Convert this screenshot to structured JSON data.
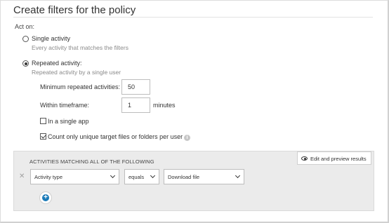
{
  "header": {
    "title": "Create filters for the policy"
  },
  "act_on": {
    "label": "Act on:",
    "single": {
      "label": "Single activity",
      "description": "Every activity that matches the filters",
      "selected": false
    },
    "repeated": {
      "label": "Repeated activity:",
      "description": "Repeated activity by a single user",
      "selected": true
    }
  },
  "repeated_settings": {
    "min_label": "Minimum repeated activities:",
    "min_value": "50",
    "timeframe_label": "Within timeframe:",
    "timeframe_value": "1",
    "timeframe_unit": "minutes",
    "single_app_label": "In a single app",
    "single_app_checked": false,
    "unique_label": "Count only unique target files or folders per user",
    "unique_checked": true
  },
  "activities": {
    "heading": "ACTIVITIES MATCHING ALL OF THE FOLLOWING",
    "preview_label": "Edit and preview results",
    "filter": {
      "remove_glyph": "✕",
      "field": "Activity type",
      "operator": "equals",
      "value": "Download file"
    },
    "add_glyph": "+"
  },
  "colors": {
    "accent": "#1a7ab8",
    "panel_bg": "#ebebeb"
  }
}
